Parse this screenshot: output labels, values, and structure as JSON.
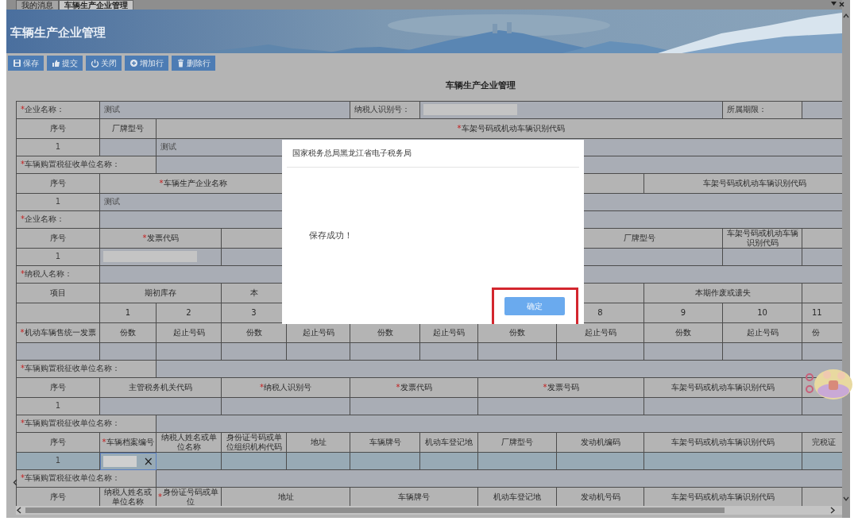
{
  "tabs": [
    {
      "label": "我的消息",
      "selected": false
    },
    {
      "label": "车辆生产企业管理",
      "selected": true
    }
  ],
  "banner": {
    "title": "车辆生产企业管理"
  },
  "toolbar": [
    {
      "label": "保存"
    },
    {
      "label": "提交"
    },
    {
      "label": "关闭"
    },
    {
      "label": "增加行"
    },
    {
      "label": "删除行"
    }
  ],
  "form": {
    "title": "车辆生产企业管理",
    "rows": [
      {
        "kind": "field",
        "cells": [
          {
            "kind": "label",
            "text": "*企业名称：",
            "required": true
          },
          {
            "kind": "value",
            "text": "测试"
          },
          "",
          "",
          "",
          {
            "kind": "label",
            "text": "纳税人识别号："
          },
          {
            "kind": "blurred"
          },
          "",
          "",
          "",
          {
            "kind": "label",
            "text": "所属期限："
          },
          {
            "kind": "value"
          }
        ]
      },
      {
        "kind": "header",
        "cells": [
          {
            "kind": "header",
            "text": "序号"
          },
          {
            "kind": "header",
            "text": "厂牌型号"
          },
          "",
          "",
          "",
          "",
          "",
          {
            "kind": "header",
            "text": "*车架号码或机动车辆识别代码",
            "required": true
          },
          "",
          "",
          "",
          ""
        ]
      },
      {
        "kind": "data",
        "selected": false,
        "cells": [
          {
            "kind": "index",
            "text": "1"
          },
          {
            "kind": "value"
          },
          {
            "kind": "value",
            "text": "测试"
          },
          "",
          "",
          "",
          "",
          "",
          "",
          "",
          "",
          ""
        ]
      },
      {
        "kind": "field",
        "cells": [
          {
            "kind": "label",
            "text": "*车辆购置税征收单位名称：",
            "required": true
          },
          "",
          {
            "kind": "value"
          },
          "",
          "",
          "",
          "",
          "",
          "",
          "",
          "",
          ""
        ]
      },
      {
        "kind": "header",
        "cells": [
          {
            "kind": "header",
            "text": "序号"
          },
          {
            "kind": "header",
            "text": "*车辆生产企业名称",
            "required": true
          },
          "",
          "",
          {
            "kind": "header"
          },
          "",
          "",
          "",
          "",
          {
            "kind": "header",
            "text": "车架号码或机动车辆识别代码"
          },
          "",
          ""
        ]
      },
      {
        "kind": "data",
        "selected": false,
        "cells": [
          {
            "kind": "index",
            "text": "1"
          },
          {
            "kind": "value",
            "text": "测试"
          },
          "",
          "",
          "",
          "",
          "",
          "",
          "",
          "",
          "",
          ""
        ]
      },
      {
        "kind": "field",
        "cells": [
          {
            "kind": "label",
            "text": "*企业名称：",
            "required": true
          },
          {
            "kind": "value"
          },
          "",
          "",
          "",
          "",
          "",
          "",
          "",
          "",
          "",
          ""
        ]
      },
      {
        "kind": "header",
        "cells": [
          {
            "kind": "header",
            "text": "序号"
          },
          {
            "kind": "header",
            "text": "*发票代码",
            "required": true
          },
          "",
          {
            "kind": "header"
          },
          "",
          "",
          "",
          "",
          {
            "kind": "header",
            "text": "厂牌型号"
          },
          "",
          {
            "kind": "header",
            "text": "车架号码或机动车辆识别代码"
          },
          {
            "kind": "header"
          }
        ]
      },
      {
        "kind": "data",
        "selected": false,
        "cells": [
          {
            "kind": "index",
            "text": "1"
          },
          {
            "kind": "blurred"
          },
          "",
          {
            "kind": "value"
          },
          "",
          "",
          "",
          "",
          {
            "kind": "value"
          },
          "",
          {
            "kind": "value"
          },
          {
            "kind": "value"
          }
        ]
      },
      {
        "kind": "field",
        "cells": [
          {
            "kind": "label",
            "text": "*纳税人名称：",
            "required": true
          },
          {
            "kind": "value"
          },
          "",
          "",
          "",
          "",
          "",
          "",
          "",
          "",
          "",
          ""
        ]
      },
      {
        "kind": "header",
        "cells": [
          {
            "kind": "header",
            "text": "项目"
          },
          {
            "kind": "header",
            "text": "期初库存"
          },
          "",
          {
            "kind": "header",
            "text": "本"
          },
          {
            "kind": "header"
          },
          "",
          "",
          "",
          "",
          {
            "kind": "header",
            "text": "本期作废或遗失"
          },
          "",
          {
            "kind": "header"
          }
        ]
      },
      {
        "kind": "header",
        "cells": [
          {
            "kind": "header"
          },
          {
            "kind": "header",
            "text": "1"
          },
          {
            "kind": "header",
            "text": "2"
          },
          {
            "kind": "header",
            "text": "3"
          },
          "",
          "",
          "",
          "",
          {
            "kind": "header",
            "text": "8"
          },
          {
            "kind": "header",
            "text": "9"
          },
          {
            "kind": "header",
            "text": "10"
          },
          {
            "kind": "header",
            "text": "11"
          }
        ]
      },
      {
        "kind": "header",
        "cells": [
          {
            "kind": "header",
            "text": "*机动车辆售统一发票",
            "required": true
          },
          {
            "kind": "header",
            "text": "份数"
          },
          {
            "kind": "header",
            "text": "起止号码"
          },
          {
            "kind": "header",
            "text": "份数"
          },
          {
            "kind": "header",
            "text": "起止号码"
          },
          {
            "kind": "header",
            "text": "份数"
          },
          {
            "kind": "header",
            "text": "起止号码"
          },
          {
            "kind": "header",
            "text": "份数"
          },
          {
            "kind": "header",
            "text": "起止号码"
          },
          {
            "kind": "header",
            "text": "份数"
          },
          {
            "kind": "header",
            "text": "起止号码"
          },
          {
            "kind": "header",
            "text": "份"
          }
        ]
      },
      {
        "kind": "data",
        "selected": false,
        "cells": [
          {
            "kind": "value"
          },
          {
            "kind": "value"
          },
          {
            "kind": "value"
          },
          {
            "kind": "value"
          },
          {
            "kind": "value"
          },
          {
            "kind": "value"
          },
          {
            "kind": "value"
          },
          {
            "kind": "value"
          },
          {
            "kind": "value"
          },
          {
            "kind": "value"
          },
          {
            "kind": "value"
          },
          {
            "kind": "value"
          }
        ]
      },
      {
        "kind": "field",
        "cells": [
          {
            "kind": "label",
            "text": "*车辆购置税征收单位名称：",
            "required": true
          },
          "",
          {
            "kind": "value"
          },
          "",
          "",
          "",
          "",
          "",
          "",
          "",
          "",
          ""
        ]
      },
      {
        "kind": "header",
        "cells": [
          {
            "kind": "header",
            "text": "序号"
          },
          {
            "kind": "header",
            "text": "主管税务机关代码"
          },
          "",
          {
            "kind": "header",
            "text": "*纳税人识别号",
            "required": true
          },
          "",
          {
            "kind": "header",
            "text": "*发票代码",
            "required": true
          },
          "",
          {
            "kind": "header",
            "text": "*发票号码",
            "required": true
          },
          "",
          {
            "kind": "header",
            "text": "车架号码或机动车辆识别代码"
          },
          "",
          {
            "kind": "header"
          }
        ]
      },
      {
        "kind": "data",
        "selected": false,
        "cells": [
          {
            "kind": "index",
            "text": "1"
          },
          {
            "kind": "value"
          },
          "",
          {
            "kind": "value"
          },
          "",
          {
            "kind": "value"
          },
          "",
          {
            "kind": "value"
          },
          "",
          {
            "kind": "value"
          },
          "",
          {
            "kind": "value"
          }
        ]
      },
      {
        "kind": "field",
        "cells": [
          {
            "kind": "label",
            "text": "*车辆购置税征收单位名称：",
            "required": true
          },
          "",
          {
            "kind": "value"
          },
          "",
          "",
          "",
          "",
          "",
          "",
          "",
          "",
          ""
        ]
      },
      {
        "kind": "header",
        "cells": [
          {
            "kind": "header",
            "text": "序号"
          },
          {
            "kind": "header",
            "text": "*车辆档案编号",
            "required": true
          },
          {
            "kind": "header",
            "text": "纳税人姓名或单位名称"
          },
          {
            "kind": "header",
            "text": "身份证号码或单位组织机构代码"
          },
          {
            "kind": "header",
            "text": "地址"
          },
          {
            "kind": "header",
            "text": "车辆牌号"
          },
          {
            "kind": "header",
            "text": "机动车登记地"
          },
          {
            "kind": "header",
            "text": "厂牌型号"
          },
          {
            "kind": "header",
            "text": "发动机编码"
          },
          {
            "kind": "header",
            "text": "车架号码或机动车辆识别代码"
          },
          "",
          {
            "kind": "header",
            "text": "完税证"
          }
        ]
      },
      {
        "kind": "data",
        "selected": true,
        "cells": [
          {
            "kind": "index",
            "text": "1"
          },
          {
            "kind": "input",
            "clear": "×"
          },
          {
            "kind": "value"
          },
          {
            "kind": "value"
          },
          {
            "kind": "value"
          },
          {
            "kind": "value"
          },
          {
            "kind": "value"
          },
          {
            "kind": "value"
          },
          {
            "kind": "value"
          },
          {
            "kind": "value"
          },
          "",
          {
            "kind": "value"
          }
        ]
      },
      {
        "kind": "field",
        "cells": [
          {
            "kind": "label",
            "text": "*车辆购置税征收单位名称：",
            "required": true
          },
          "",
          {
            "kind": "value"
          },
          "",
          "",
          "",
          "",
          "",
          "",
          "",
          "",
          ""
        ]
      },
      {
        "kind": "header",
        "cells": [
          {
            "kind": "header",
            "text": "序号"
          },
          {
            "kind": "header",
            "text": "纳税人姓名或单位名称"
          },
          {
            "kind": "header",
            "text": "*身份证号码或单位",
            "required": true
          },
          {
            "kind": "header",
            "text": "地址"
          },
          "",
          {
            "kind": "header",
            "text": "车辆牌号"
          },
          "",
          {
            "kind": "header",
            "text": "机动车登记地"
          },
          {
            "kind": "header",
            "text": "发动机号码"
          },
          {
            "kind": "header",
            "text": "车架号码或机动车辆识别代码"
          },
          "",
          {
            "kind": "header"
          }
        ]
      }
    ]
  },
  "dialog": {
    "title": "国家税务总局黑龙江省电子税务局",
    "message": "保存成功！",
    "button": "确定"
  }
}
